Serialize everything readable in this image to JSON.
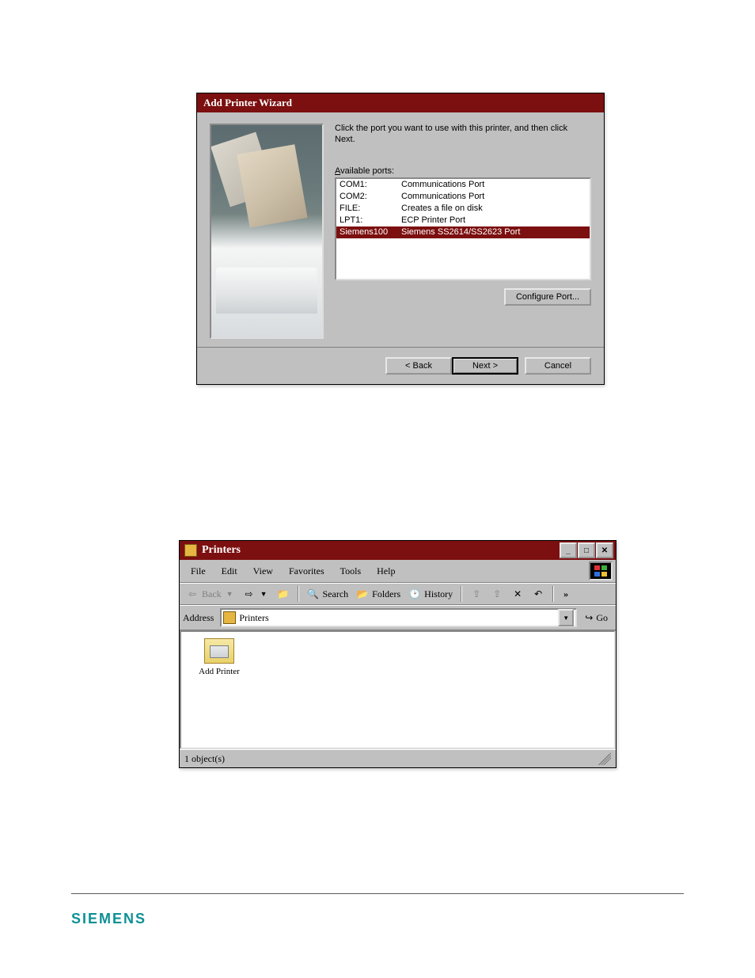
{
  "wizard": {
    "title": "Add Printer Wizard",
    "instruction": "Click the port you want to use with this printer, and then click Next.",
    "available_ports_label_pre": "A",
    "available_ports_label_post": "vailable ports:",
    "ports": [
      {
        "name": "COM1:",
        "desc": "Communications Port",
        "selected": false
      },
      {
        "name": "COM2:",
        "desc": "Communications Port",
        "selected": false
      },
      {
        "name": "FILE:",
        "desc": "Creates a file on disk",
        "selected": false
      },
      {
        "name": "LPT1:",
        "desc": "ECP Printer Port",
        "selected": false
      },
      {
        "name": "Siemens100",
        "desc": "Siemens SS2614/SS2623 Port",
        "selected": true
      }
    ],
    "configure_port_label": "Configure Port...",
    "back_label": "< Back",
    "next_label": "Next >",
    "cancel_label": "Cancel"
  },
  "printers_window": {
    "title": "Printers",
    "menus": [
      "File",
      "Edit",
      "View",
      "Favorites",
      "Tools",
      "Help"
    ],
    "toolbar": {
      "back_label": "Back",
      "search_label": "Search",
      "folders_label": "Folders",
      "history_label": "History"
    },
    "address_label": "Address",
    "address_value": "Printers",
    "go_label": "Go",
    "items": [
      {
        "label": "Add Printer"
      }
    ],
    "status": "1 object(s)"
  },
  "footer": {
    "brand": "SIEMENS"
  }
}
